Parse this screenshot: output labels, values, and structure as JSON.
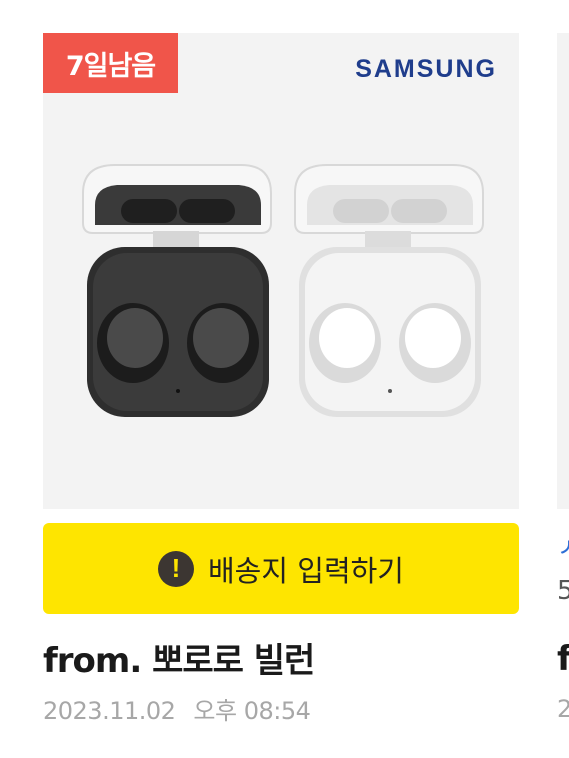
{
  "card": {
    "days_left_badge": "7일남음",
    "brand": "SAMSUNG",
    "image_alt": "Samsung Galaxy Buds earbuds in graphite and white charging cases",
    "address_button_label": "배송지 입력하기",
    "alert_icon_glyph": "!",
    "sender": "from. 뽀로로 빌런",
    "date": "2023.11.02",
    "time": "오후 08:54"
  },
  "next_card_peek": {
    "line1": "ㅅ",
    "line2": "5",
    "line3": "f",
    "line4": "2"
  },
  "colors": {
    "badge": "#f0554a",
    "brand_logo": "#1f3d8c",
    "address_button": "#fee500",
    "alert_icon": "#3c3632"
  }
}
